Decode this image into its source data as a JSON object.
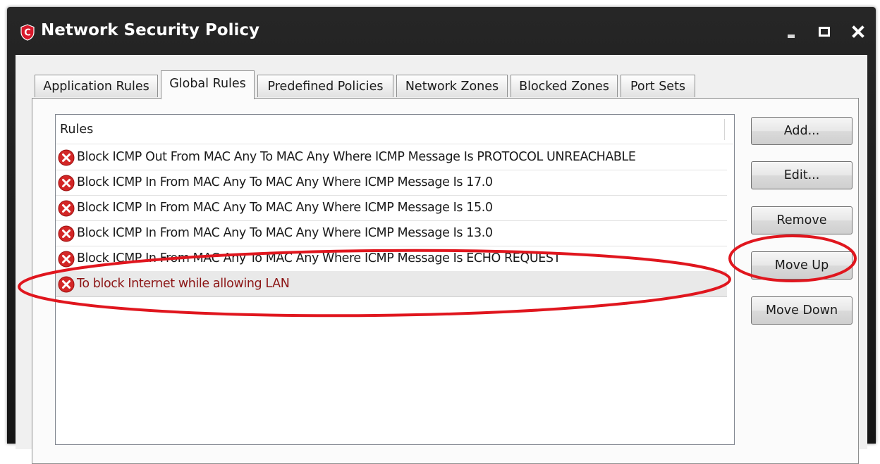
{
  "window": {
    "title": "Network Security Policy",
    "logo_letter": "C",
    "accent_color": "#d7192a"
  },
  "tabs": [
    {
      "label": "Application Rules",
      "active": false
    },
    {
      "label": "Global Rules",
      "active": true
    },
    {
      "label": "Predefined Policies",
      "active": false
    },
    {
      "label": "Network Zones",
      "active": false
    },
    {
      "label": "Blocked Zones",
      "active": false
    },
    {
      "label": "Port Sets",
      "active": false
    }
  ],
  "rules_list": {
    "header": "Rules",
    "rows": [
      {
        "text": "Block ICMP Out From MAC Any To MAC Any Where ICMP Message Is PROTOCOL UNREACHABLE",
        "icon": "block-error-icon"
      },
      {
        "text": "Block ICMP In From MAC Any To MAC Any Where ICMP Message Is 17.0",
        "icon": "block-error-icon"
      },
      {
        "text": "Block ICMP In From MAC Any To MAC Any Where ICMP Message Is 15.0",
        "icon": "block-error-icon"
      },
      {
        "text": "Block ICMP In From MAC Any To MAC Any Where ICMP Message Is 13.0",
        "icon": "block-error-icon"
      },
      {
        "text": "Block ICMP In From MAC Any To MAC Any Where ICMP Message Is ECHO REQUEST",
        "icon": "block-error-icon"
      },
      {
        "text": "To block Internet while allowing LAN",
        "icon": "block-error-icon",
        "selected": true
      }
    ]
  },
  "buttons": {
    "add": "Add...",
    "edit": "Edit...",
    "remove": "Remove",
    "move_up": "Move Up",
    "move_down": "Move Down"
  },
  "annotation_color": "#e0161e"
}
